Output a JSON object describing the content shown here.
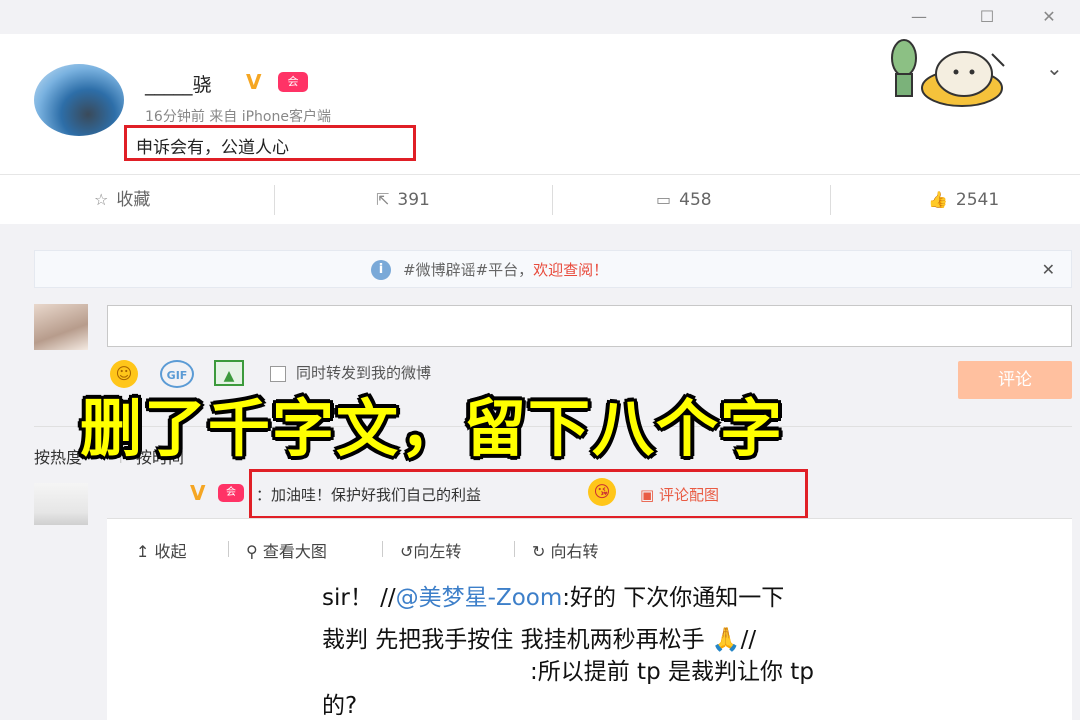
{
  "window": {
    "minimize_glyph": "—",
    "maximize_glyph": "☐",
    "close_glyph": "✕"
  },
  "post": {
    "username": "_____骁",
    "verified_glyph": "V",
    "member_badge": "会",
    "meta": "16分钟前 来自 iPhone客户端",
    "text": "申诉会有，公道人心",
    "expand_glyph": "⌄"
  },
  "actions": {
    "favorite_label": "收藏",
    "repost_count": "391",
    "comment_count": "458",
    "like_count": "2541"
  },
  "notice": {
    "text_plain": "#微博辟谣#平台，",
    "text_highlight": "欢迎查阅！",
    "close_glyph": "✕"
  },
  "composer": {
    "input_value": "",
    "also_repost_label": "同时转发到我的微博",
    "submit_label": "评论",
    "gif_label": "GIF"
  },
  "overlay_caption": "删了千字文，留下八个字",
  "sort": {
    "hot": "按热度",
    "time": "按时间"
  },
  "comment": {
    "text": "：加油哇！保护好我们自己的利益",
    "image_link": "评论配图"
  },
  "image_toolbar": {
    "collapse": "收起",
    "view_large": "查看大图",
    "rotate_left": "向左转",
    "rotate_right": "向右转"
  },
  "screenshot_text": {
    "line1_a": "sir！ //",
    "line1_mention": "@美梦星-Zoom",
    "line1_b": ":好的 下次你通知一下",
    "line2": "裁判 先把我手按住 我挂机两秒再松手 🙏//",
    "line3": ":所以提前 tp 是裁判让你 tp",
    "line4": "的?"
  },
  "colors": {
    "highlight_box": "#e01f26",
    "overlay_text": "#ffff00",
    "accent_orange": "#e95b43",
    "verified": "#f5a623"
  }
}
